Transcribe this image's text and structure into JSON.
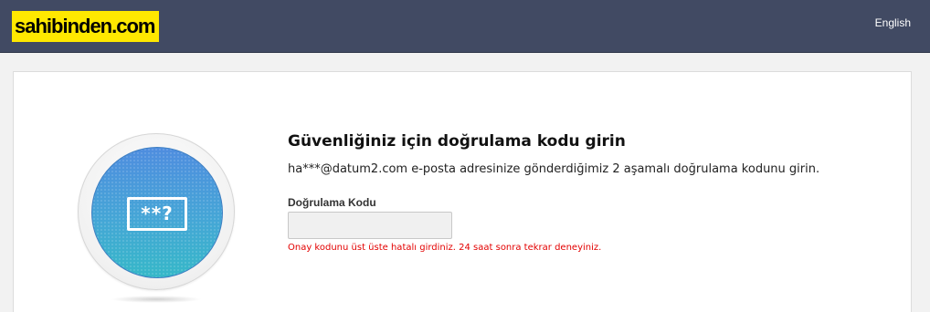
{
  "header": {
    "logo_text": "sahibinden.com",
    "language_link": "English",
    "colors": {
      "bar_background": "#414a63",
      "logo_background": "#ffe800"
    }
  },
  "verification": {
    "icon_name": "verification-code-icon",
    "icon_text": "**?",
    "title": "Güvenliğiniz için doğrulama kodu girin",
    "description": "ha***@datum2.com e-posta adresinize gönderdiğimiz 2 aşamalı doğrulama kodunu girin.",
    "field_label": "Doğrulama Kodu",
    "field_value": "",
    "field_placeholder": "",
    "error_message": "Onay kodunu üst üste hatalı girdiniz. 24 saat sonra tekrar deneyiniz.",
    "colors": {
      "error": "#e30000",
      "badge_blue": "#4f8ddf",
      "badge_teal": "#36b8c8"
    }
  }
}
